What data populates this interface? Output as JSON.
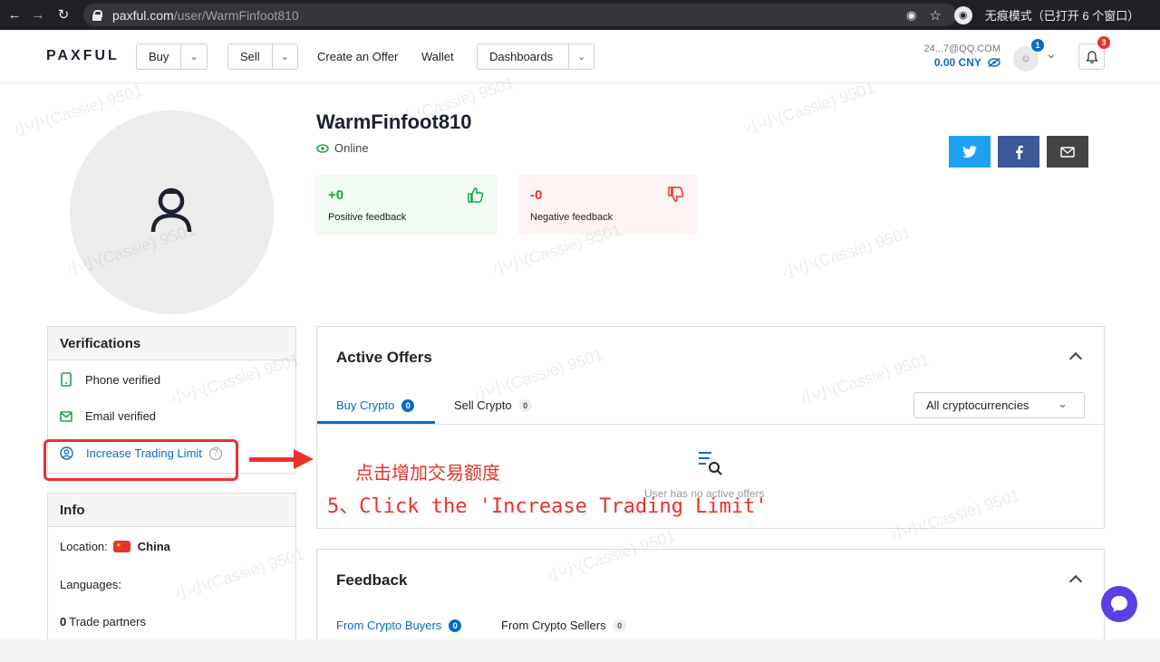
{
  "browser": {
    "url_host": "paxful.com",
    "url_path": "/user/WarmFinfoot810",
    "incognito_label": "无痕模式（已打开 6 个窗口）"
  },
  "header": {
    "logo": "PAXFUL",
    "buy_label": "Buy",
    "sell_label": "Sell",
    "create_offer_label": "Create an Offer",
    "wallet_label": "Wallet",
    "dashboards_label": "Dashboards",
    "account_email": "24...7@QQ.COM",
    "balance": "0.00 CNY",
    "avatar_badge": "1",
    "notif_badge": "3"
  },
  "profile": {
    "username": "WarmFinfoot810",
    "status": "Online",
    "positive_count": "+0",
    "positive_label": "Positive feedback",
    "negative_count": "-0",
    "negative_label": "Negative feedback"
  },
  "verifications": {
    "title": "Verifications",
    "phone": "Phone verified",
    "email": "Email verified",
    "increase_limit": "Increase Trading Limit"
  },
  "info": {
    "title": "Info",
    "location_label": "Location:",
    "location_value": "China",
    "languages_label": "Languages:",
    "trade_partners_count": "0",
    "trade_partners_label": "Trade partners"
  },
  "active_offers": {
    "title": "Active Offers",
    "tab_buy": "Buy Crypto",
    "tab_buy_count": "0",
    "tab_sell": "Sell Crypto",
    "tab_sell_count": "0",
    "currency_select": "All cryptocurrencies",
    "empty_text": "User has no active offers"
  },
  "feedback": {
    "title": "Feedback",
    "tab_buyers": "From Crypto Buyers",
    "tab_buyers_count": "0",
    "tab_sellers": "From Crypto Sellers",
    "tab_sellers_count": "0"
  },
  "annotation": {
    "cn": "点击增加交易额度",
    "en": "5、Click the 'Increase Trading Limit'"
  },
  "watermark_text": "小小(Cassie) 9501",
  "colors": {
    "accent_blue": "#0a6bc2",
    "green": "#1aa34a",
    "red": "#e8322b",
    "twitter": "#1da1f2",
    "facebook": "#3b5998",
    "mail": "#444444"
  }
}
